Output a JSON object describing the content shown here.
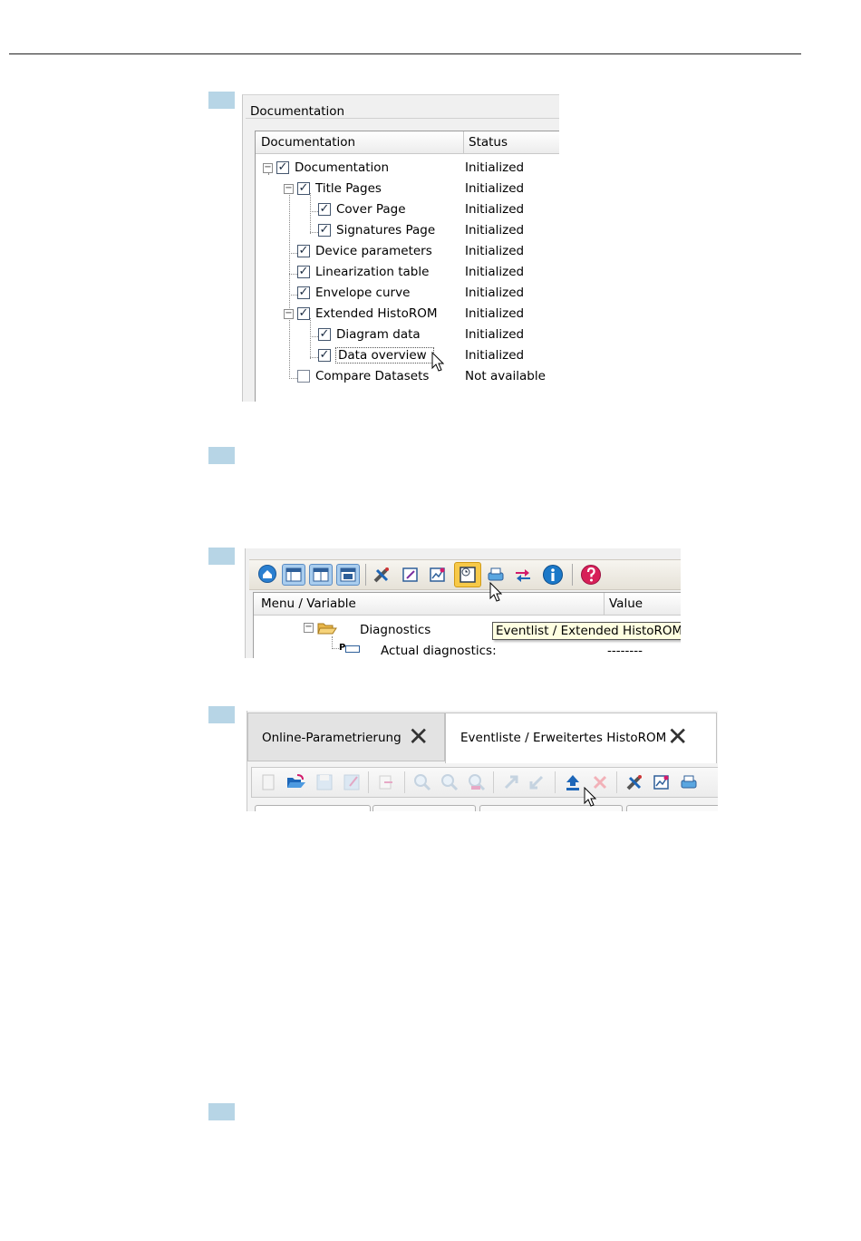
{
  "fig1": {
    "group_title": "Documentation",
    "columns": [
      "Documentation",
      "Status"
    ],
    "rows": [
      {
        "label": "Documentation",
        "status": "Initialized",
        "checked": true
      },
      {
        "label": "Title Pages",
        "status": "Initialized",
        "checked": true
      },
      {
        "label": "Cover Page",
        "status": "Initialized",
        "checked": true
      },
      {
        "label": "Signatures Page",
        "status": "Initialized",
        "checked": true
      },
      {
        "label": "Device parameters",
        "status": "Initialized",
        "checked": true
      },
      {
        "label": "Linearization table",
        "status": "Initialized",
        "checked": true
      },
      {
        "label": "Envelope curve",
        "status": "Initialized",
        "checked": true
      },
      {
        "label": "Extended HistoROM",
        "status": "Initialized",
        "checked": true
      },
      {
        "label": "Diagram data",
        "status": "Initialized",
        "checked": true
      },
      {
        "label": "Data overview",
        "status": "Initialized",
        "checked": true
      },
      {
        "label": "Compare Datasets",
        "status": "Not available",
        "checked": false
      }
    ]
  },
  "fig2": {
    "columns": [
      "Menu / Variable",
      "Value"
    ],
    "tree": {
      "folder": "Diagnostics",
      "param_prefix": "P",
      "param": "Actual diagnostics:",
      "param_value": "--------"
    },
    "tooltip": "Eventlist / Extended HistoROM",
    "toolbar_icons": [
      "home-icon",
      "layout-1-icon",
      "layout-2-icon",
      "layout-3-icon",
      "tools-icon",
      "edit-icon",
      "chart-icon",
      "eventlist-icon",
      "print-icon",
      "compare-icon",
      "info-icon",
      "help-icon"
    ],
    "colors": {
      "home": "#2a7fd0",
      "info": "#1b78c8",
      "help": "#d72058",
      "highlight": "#f7c948"
    }
  },
  "fig3": {
    "tabs": [
      {
        "label": "Online-Parametrierung",
        "close": "✕"
      },
      {
        "label": "Eventliste / Erweitertes HistoROM",
        "close": "✕"
      }
    ],
    "toolbar_icons": [
      "new-icon",
      "open-icon",
      "save-icon",
      "save-as-icon",
      "export-icon",
      "zoom-in-icon",
      "zoom-out-icon",
      "zoom-reset-icon",
      "upload-icon",
      "download-icon",
      "read-from-device-icon",
      "delete-icon",
      "tools-icon",
      "chart-icon",
      "print-icon"
    ]
  }
}
